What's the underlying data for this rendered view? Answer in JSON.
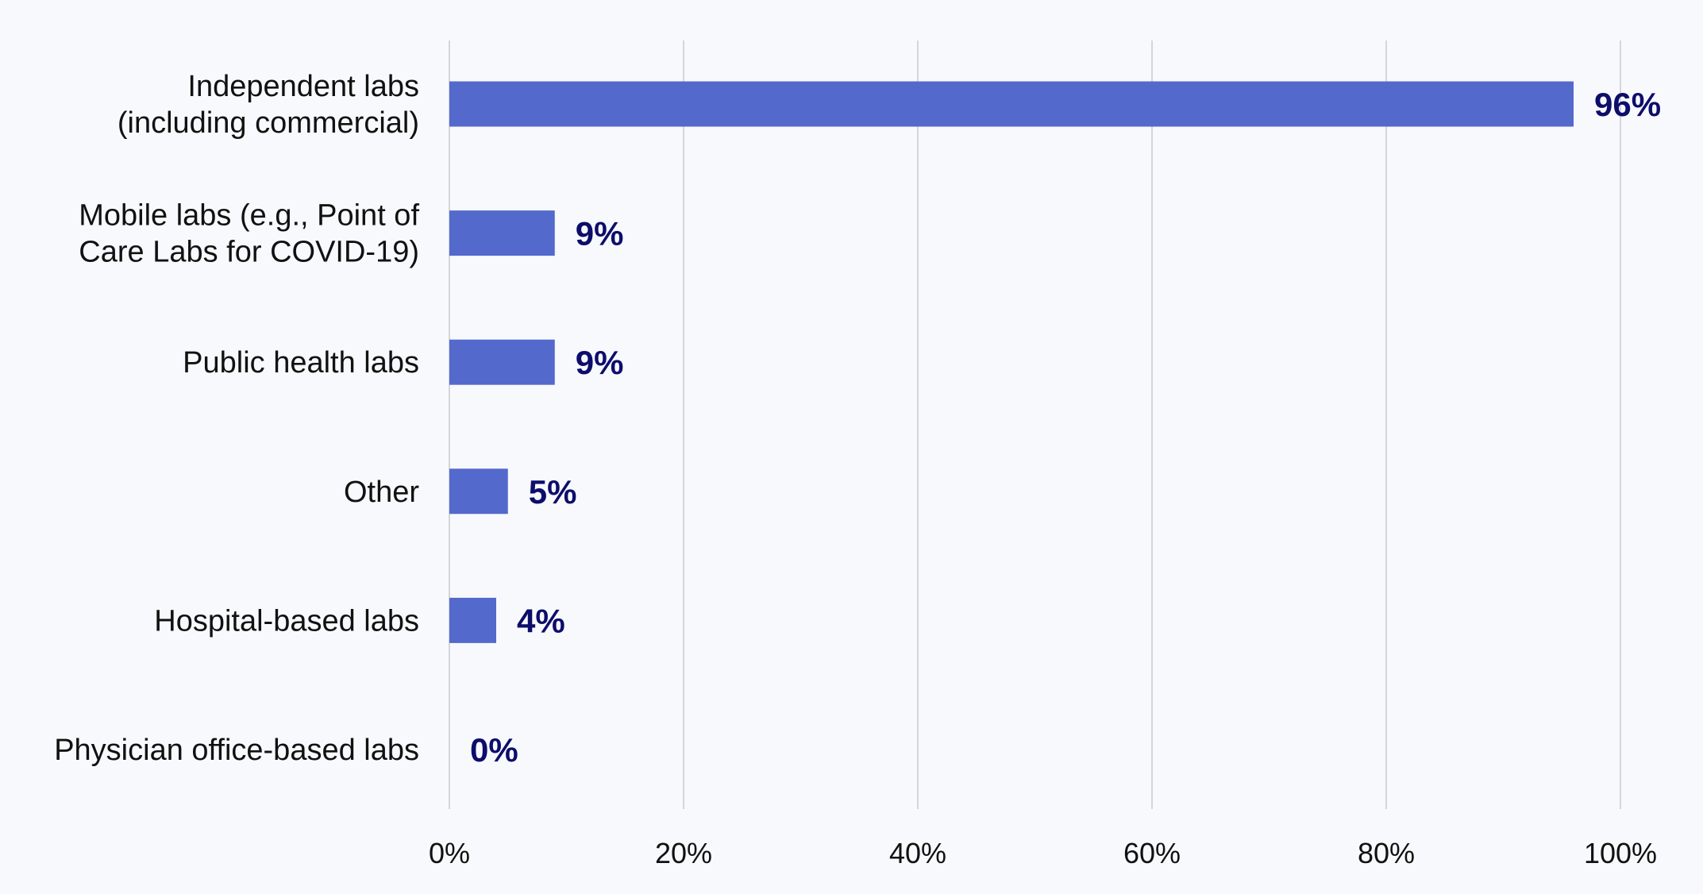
{
  "chart_data": {
    "type": "bar",
    "orientation": "horizontal",
    "title": "",
    "xlabel": "",
    "ylabel": "",
    "categories": [
      [
        "Independent labs",
        "(including commercial)"
      ],
      [
        "Mobile labs (e.g., Point of",
        "Care Labs for COVID-19)"
      ],
      [
        "Public health labs"
      ],
      [
        "Other"
      ],
      [
        "Hospital-based labs"
      ],
      [
        "Physician office-based labs"
      ]
    ],
    "values": [
      96,
      9,
      9,
      5,
      4,
      0
    ],
    "value_labels": [
      "96%",
      "9%",
      "9%",
      "5%",
      "4%",
      "0%"
    ],
    "xlim": [
      0,
      100
    ],
    "xticks": [
      0,
      20,
      40,
      60,
      80,
      100
    ],
    "xtick_labels": [
      "0%",
      "20%",
      "40%",
      "60%",
      "80%",
      "100%"
    ],
    "grid": true,
    "legend": "none",
    "colors": {
      "bar": "#5469cc",
      "value_label": "#0d0d6b",
      "grid": "#d4d6db",
      "background": "#f8f9fc"
    }
  }
}
